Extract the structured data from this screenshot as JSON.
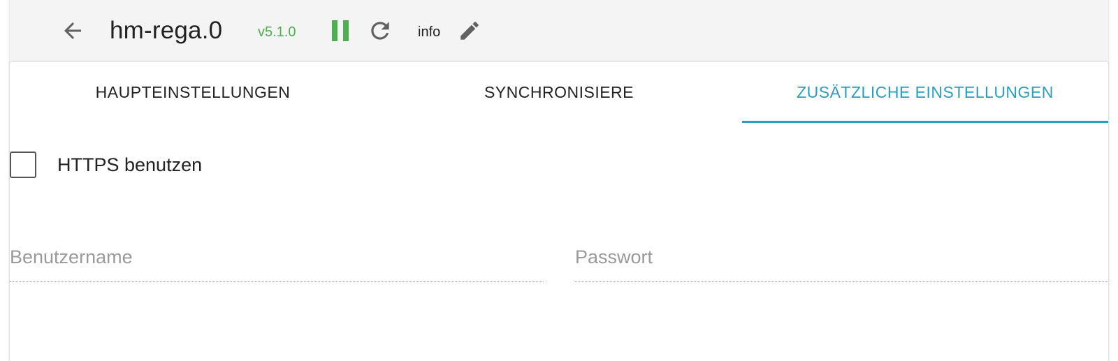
{
  "header": {
    "back_icon": "arrow-left-icon",
    "title": "hm-rega.0",
    "version": "v5.1.0",
    "pause_icon": "pause-icon",
    "reload_icon": "reload-icon",
    "info_label": "info",
    "edit_icon": "pencil-icon"
  },
  "tabs": [
    {
      "label": "HAUPTEINSTELLUNGEN",
      "active": false
    },
    {
      "label": "SYNCHRONISIERE",
      "active": false
    },
    {
      "label": "ZUSÄTZLICHE EINSTELLUNGEN",
      "active": true
    }
  ],
  "form": {
    "https_checkbox": {
      "label": "HTTPS benutzen",
      "checked": false
    },
    "username": {
      "placeholder": "Benutzername",
      "value": ""
    },
    "password": {
      "placeholder": "Passwort",
      "value": ""
    }
  },
  "colors": {
    "accent": "#2a9fbd",
    "running_green": "#4caf50",
    "icon_grey": "#616161",
    "header_bg": "#f4f4f4"
  }
}
